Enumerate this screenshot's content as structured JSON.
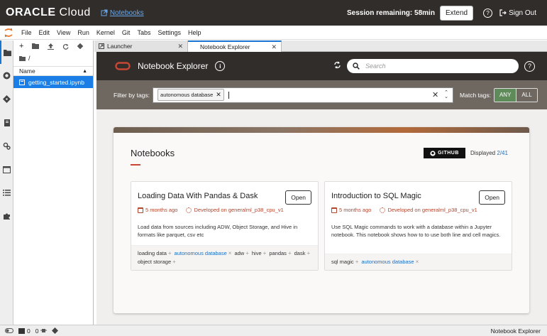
{
  "topbar": {
    "brand_bold": "ORACLE",
    "brand_light": " Cloud",
    "nav_link": "Notebooks",
    "session_text": "Session remaining: 58min",
    "extend_label": "Extend",
    "help_symbol": "?",
    "signout_label": "Sign Out"
  },
  "menubar": {
    "items": [
      "File",
      "Edit",
      "View",
      "Run",
      "Kernel",
      "Git",
      "Tabs",
      "Settings",
      "Help"
    ]
  },
  "filebrowser": {
    "path": "/",
    "column_header": "Name",
    "files": [
      {
        "name": "getting_started.ipynb"
      }
    ]
  },
  "tabs": [
    {
      "label": "Launcher"
    },
    {
      "label": "Notebook Explorer"
    }
  ],
  "explorer": {
    "title": "Notebook Explorer",
    "info_symbol": "i",
    "search_placeholder": "Search",
    "help_symbol": "?",
    "filter_label": "Filter by tags:",
    "filter_chip": "autonomous database",
    "match_label": "Match tags:",
    "match_any": "ANY",
    "match_all": "ALL"
  },
  "panel": {
    "title": "Notebooks",
    "github_label": "GITHUB",
    "displayed_label": "Displayed",
    "displayed_count": "2/41"
  },
  "cards": [
    {
      "title": "Loading Data With Pandas & Dask",
      "open_label": "Open",
      "age": "5 months ago",
      "env": "Developed on generalml_p38_cpu_v1",
      "description": "Load data from sources including ADW, Object Storage, and Hive in formats like parquet, csv etc",
      "tags": [
        "loading data",
        "autonomous database",
        "adw",
        "hive",
        "pandas",
        "dask",
        "object storage"
      ]
    },
    {
      "title": "Introduction to SQL Magic",
      "open_label": "Open",
      "age": "5 months ago",
      "env": "Developed on generalml_p38_cpu_v1",
      "description": "Use SQL Magic commands to work with a database within a Jupyter notebook. This notebook shows how to to use both line and cell magics.",
      "tags": [
        "sql magic",
        "autonomous database"
      ]
    }
  ],
  "statusbar": {
    "count_a": "0",
    "count_b": "0",
    "right_label": "Notebook Explorer"
  },
  "colors": {
    "oracle_dark": "#312d2a",
    "oracle_red": "#c74634",
    "jupyter_blue": "#1a7ee6",
    "match_any_green": "#5f8a5a",
    "tag_highlight": "#1a6fbf"
  }
}
